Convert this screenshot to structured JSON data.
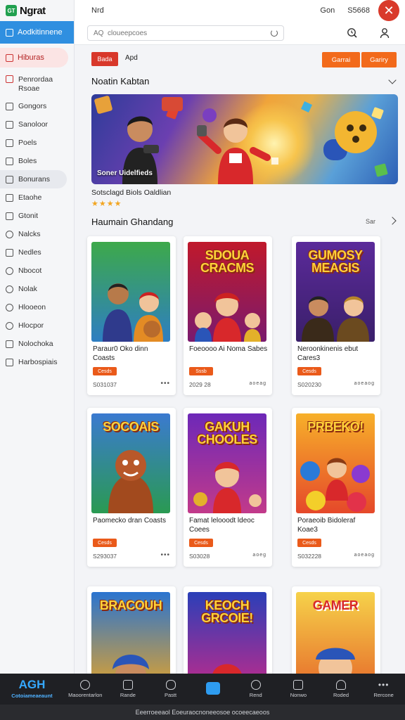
{
  "app": {
    "logo_badge": "GT",
    "logo_text": "Ngrat"
  },
  "sidebar": {
    "active_item": "Aodkitinnene",
    "selected_item": "Hiburas",
    "items": [
      {
        "label": "Penrordaa Rsoae"
      },
      {
        "label": "Gongors"
      },
      {
        "label": "Sanoloor"
      },
      {
        "label": "Poels"
      },
      {
        "label": "Boles"
      },
      {
        "label": "Bonurans"
      },
      {
        "label": "Etaohe"
      },
      {
        "label": "Gtonit"
      },
      {
        "label": "Nalcks"
      },
      {
        "label": "Nedles"
      },
      {
        "label": "Nbocot"
      },
      {
        "label": "Nolak"
      },
      {
        "label": "Hlooeon"
      },
      {
        "label": "Hlocpor"
      },
      {
        "label": "Nolochoka"
      },
      {
        "label": "Harbospiais"
      }
    ]
  },
  "topbar": {
    "title": "Nrd",
    "right_a": "Gon",
    "right_b": "S5668",
    "search_placeholder": "AQ  cloueepcoes"
  },
  "filters": {
    "chip": "Bada",
    "chip_text": "Apd",
    "btn1": "Garrai",
    "btn2": "Gariry"
  },
  "featured": {
    "heading": "Noatin Kabtan",
    "caption": "Soner Uidelfieds",
    "title": "Sotsclagd Biols Oaldlian",
    "stars": "★★★★"
  },
  "grid": {
    "heading": "Haumain Ghandang",
    "see_all": "Sar",
    "cards": [
      {
        "name": "Paraur0 Oko dinn Coasts",
        "badge": "Cesds",
        "meta": "S031037",
        "art_title": "",
        "more": "•••"
      },
      {
        "name": "Foeoooo Ai Noma Sabes",
        "badge": "Sssb",
        "meta": "2029 28",
        "art_title": "SDOUA CRACMS",
        "more": "aoeag"
      },
      {
        "name": "Neroonkinenis ebut Cares3",
        "badge": "Cesds",
        "meta": "S020230",
        "art_title": "GUMOSY MEAGIS",
        "more": "aoeaog"
      },
      {
        "name": "Paomecko dran Coasts",
        "badge": "Cesds",
        "meta": "S293037",
        "art_title": "SOCOAIS",
        "more": "•••"
      },
      {
        "name": "Famat lelooodt ldeoc Coees",
        "badge": "Cesds",
        "meta": "S03028",
        "art_title": "GAKUH CHOOLES",
        "more": "aoeg"
      },
      {
        "name": "Poraeoib Bidoleraf Koae3",
        "badge": "Cesds",
        "meta": "S032228",
        "art_title": "PRBEKO!",
        "more": "aoeaog"
      },
      {
        "name": "",
        "badge": "",
        "meta": "",
        "art_title": "BRACOUH",
        "more": ""
      },
      {
        "name": "",
        "badge": "",
        "meta": "",
        "art_title": "KEOCH GRCOIE!",
        "more": ""
      },
      {
        "name": "",
        "badge": "",
        "meta": "",
        "art_title": "GAMER",
        "more": ""
      }
    ]
  },
  "bottom_nav": {
    "logo": "AGH",
    "logo_sub": "Cotoiameaeaunt",
    "items": [
      "Maoorentarlon",
      "Rande",
      "Pastt",
      "",
      "Rend",
      "Nonwo",
      "Roded",
      "Rercone"
    ]
  },
  "footer": "Eeerroeeaol Eoeuraocnoneeosoe ocoeecaeoos",
  "colors": {
    "accent_blue": "#2f8fe0",
    "accent_red": "#d8382b",
    "accent_orange": "#f26a1b",
    "nav_bg": "#1f2024"
  }
}
